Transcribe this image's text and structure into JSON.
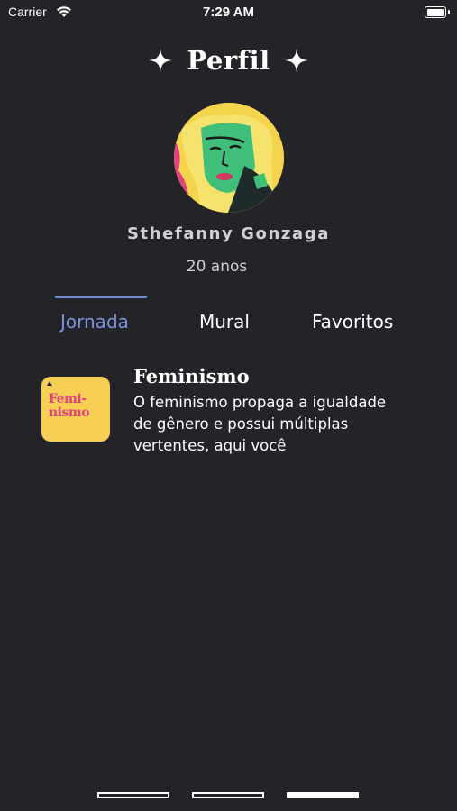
{
  "status_bar": {
    "carrier": "Carrier",
    "time": "7:29 AM"
  },
  "header": {
    "title": "Perfil"
  },
  "profile": {
    "name": "Sthefanny Gonzaga",
    "age": "20 anos"
  },
  "tabs": [
    {
      "label": "Jornada",
      "active": true
    },
    {
      "label": "Mural",
      "active": false
    },
    {
      "label": "Favoritos",
      "active": false
    }
  ],
  "journey": [
    {
      "thumbnail_text": "Femi- nismo",
      "title": "Feminismo",
      "description": "O feminismo propaga a igualdade de gênero e possui múltiplas vertentes, aqui você"
    }
  ],
  "pager": {
    "pages": 3,
    "current": 3
  },
  "colors": {
    "background": "#232328",
    "accent": "#7b93dc",
    "thumbnail_bg": "#f7cf55",
    "thumbnail_text": "#e0437f"
  }
}
